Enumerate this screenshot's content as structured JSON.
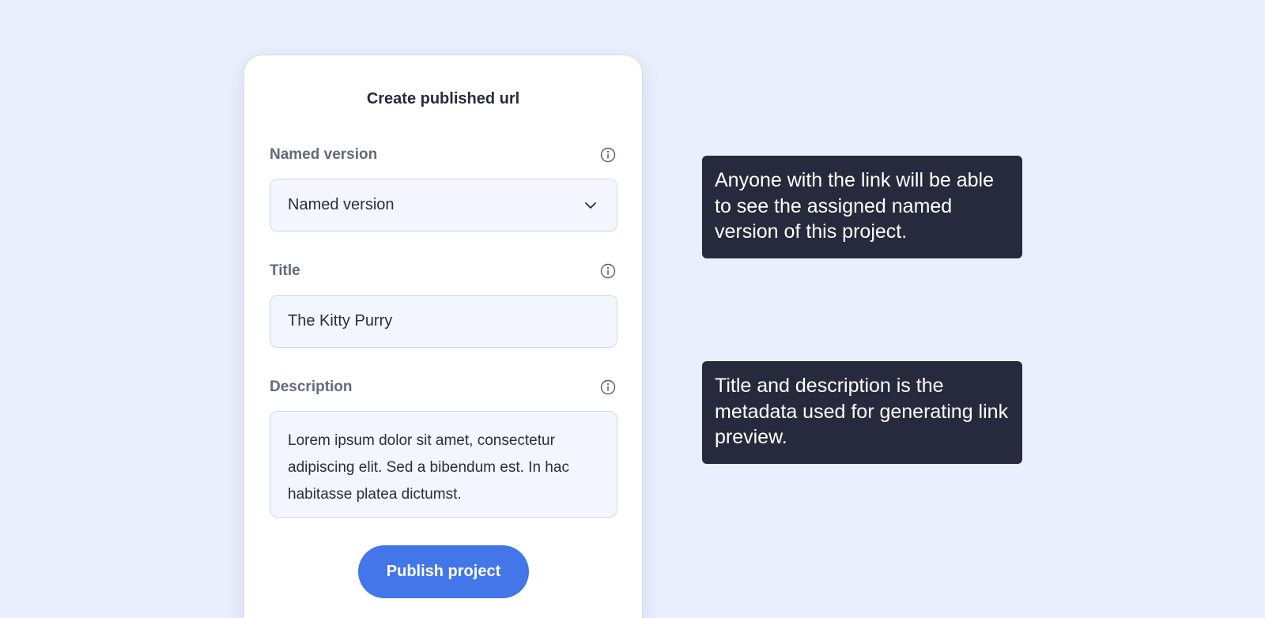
{
  "dialog": {
    "title": "Create published url",
    "fields": {
      "named_version": {
        "label": "Named version",
        "value": "Named version",
        "info_icon": "info-icon",
        "dropdown_icon": "chevron-down-icon"
      },
      "title": {
        "label": "Title",
        "value": "The Kitty Purry",
        "info_icon": "info-icon"
      },
      "description": {
        "label": "Description",
        "value": "Lorem ipsum dolor sit amet, consectetur adipiscing elit. Sed a bibendum est. In hac habitasse platea dictumst.",
        "info_icon": "info-icon"
      }
    },
    "publish_button": "Publish project"
  },
  "tooltips": [
    {
      "text": "Anyone with the link will be able to see the assigned named version of this project."
    },
    {
      "text": "Title and description is the metadata used for generating link preview."
    }
  ],
  "colors": {
    "background": "#e9effd",
    "accent": "#4376e8",
    "tooltip_bg": "#272a3d",
    "field_bg": "#f3f6fe"
  }
}
